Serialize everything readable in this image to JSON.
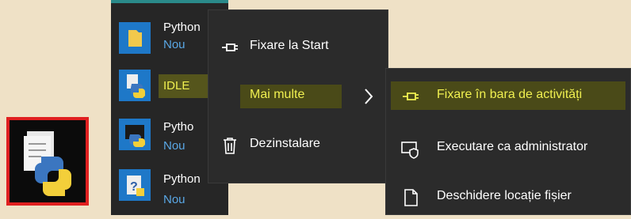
{
  "start_list": {
    "items": [
      {
        "title": "Python",
        "sub": "Nou",
        "icon": "folder-icon"
      },
      {
        "title": "IDLE",
        "sub": "",
        "icon": "python-idle-icon"
      },
      {
        "title": "Pytho",
        "sub": "Nou",
        "icon": "python-app-icon"
      },
      {
        "title": "Python",
        "sub": "Nou",
        "icon": "python-docs-icon"
      }
    ]
  },
  "context_menu": {
    "items": [
      {
        "label": "Fixare la Start",
        "icon": "pin-icon"
      },
      {
        "label": "Mai multe",
        "icon": "chevron-right-icon"
      },
      {
        "label": "Dezinstalare",
        "icon": "trash-icon"
      }
    ]
  },
  "submenu": {
    "items": [
      {
        "label": "Fixare în bara de activități",
        "icon": "pin-icon"
      },
      {
        "label": "Executare ca administrator",
        "icon": "shield-run-icon"
      },
      {
        "label": "Deschidere locație fișier",
        "icon": "file-icon"
      }
    ]
  },
  "colors": {
    "background": "#efe1c6",
    "menu_bg": "#2b2b2b",
    "tile_blue": "#1e78c8",
    "highlight": "#f0f050",
    "subtext": "#5aa8e6",
    "taskbar_icon_border": "#e02020"
  }
}
